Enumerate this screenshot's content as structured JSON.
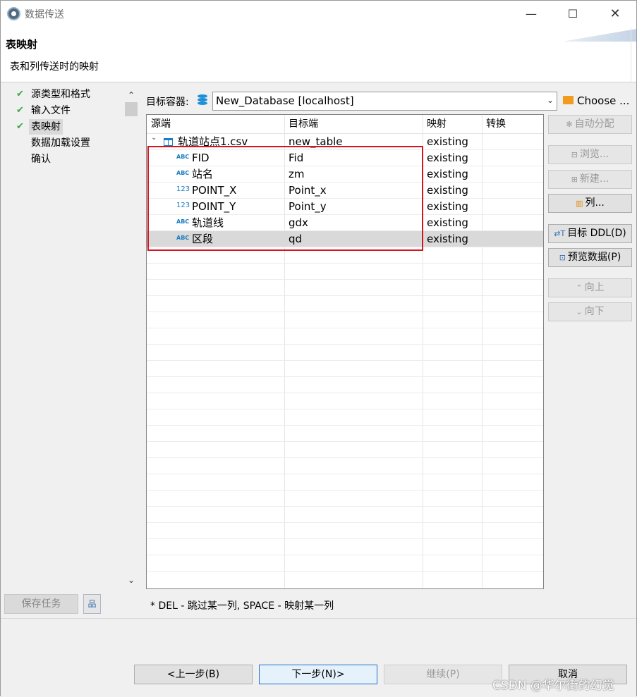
{
  "window": {
    "title": "数据传送",
    "minimize_glyph": "—",
    "maximize_glyph": "☐",
    "close_glyph": "✕"
  },
  "header": {
    "title": "表映射",
    "description": "表和列传送时的映射"
  },
  "nav": {
    "items": [
      {
        "label": "源类型和格式",
        "done": true
      },
      {
        "label": "输入文件",
        "done": true
      },
      {
        "label": "表映射",
        "done": true
      },
      {
        "label": "数据加载设置",
        "done": false
      },
      {
        "label": "确认",
        "done": false
      }
    ],
    "check_glyph": "✔",
    "scroll_up_glyph": "⌃",
    "scroll_down_glyph": "⌄",
    "save_task_label": "保存任务",
    "save_icon_glyph": "品"
  },
  "target": {
    "label": "目标容器:",
    "value": "New_Database  [localhost]",
    "dropdown_glyph": "⌄",
    "choose_label": "Choose ..."
  },
  "grid": {
    "columns": [
      "源端",
      "目标端",
      "映射",
      "转换"
    ],
    "table_row": {
      "source": "轨道站点1.csv",
      "target": "new_table",
      "mapping": "existing",
      "transform": "",
      "expand_glyph": "⌄"
    },
    "rows": [
      {
        "type": "ABC",
        "source": "FID",
        "target": "Fid",
        "mapping": "existing",
        "transform": ""
      },
      {
        "type": "ABC",
        "source": "站名",
        "target": "zm",
        "mapping": "existing",
        "transform": ""
      },
      {
        "type": "123",
        "source": "POINT_X",
        "target": "Point_x",
        "mapping": "existing",
        "transform": ""
      },
      {
        "type": "123",
        "source": "POINT_Y",
        "target": "Point_y",
        "mapping": "existing",
        "transform": ""
      },
      {
        "type": "ABC",
        "source": "轨道线",
        "target": "gdx",
        "mapping": "existing",
        "transform": ""
      },
      {
        "type": "ABC",
        "source": "区段",
        "target": "qd",
        "mapping": "existing",
        "transform": ""
      }
    ]
  },
  "side_buttons": {
    "auto_assign": "自动分配",
    "browse": "浏览...",
    "new": "新建...",
    "columns": "列...",
    "target_ddl": "目标 DDL(D)",
    "preview_data": "预览数据(P)",
    "move_up": "向上",
    "move_down": "向下",
    "auto_glyph": "✻",
    "browse_glyph": "⊟",
    "new_glyph": "⊞",
    "columns_glyph": "▥",
    "ddl_glyph": "⇄T",
    "preview_glyph": "⊡",
    "up_glyph": "⌃",
    "down_glyph": "⌄"
  },
  "hint": "* DEL - 跳过某一列, SPACE - 映射某一列",
  "footer": {
    "back": "<上一步(B)",
    "next": "下一步(N)>",
    "continue": "继续(P)",
    "cancel": "取消"
  },
  "watermark": "CSDN @华尔街的幻觉"
}
